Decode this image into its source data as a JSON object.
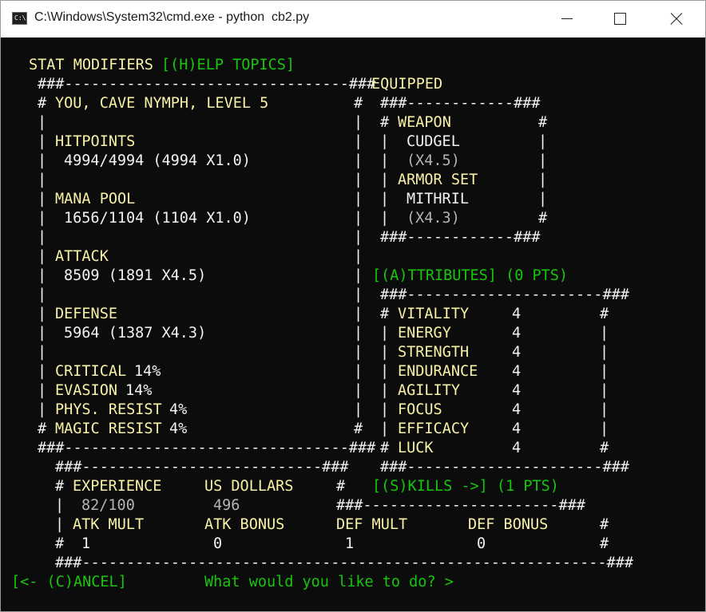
{
  "window": {
    "title": "C:\\Windows\\System32\\cmd.exe - python  cb2.py",
    "icon": "cmd-console-icon",
    "icon_text": "C:\\"
  },
  "colors": {
    "yellow": "#f9f1a5",
    "green": "#16c60c",
    "white": "#f2f2f2",
    "dim": "#b4b4b4"
  },
  "header": {
    "stat_modifiers": "STAT MODIFIERS",
    "help_topics": "[(H)ELP TOPICS]"
  },
  "stats": {
    "top_border": "###--------------------------------###",
    "player": "YOU, CAVE NYMPH, LEVEL 5",
    "hitpoints_label": "HITPOINTS",
    "hitpoints_value": "4994/4994 (4994 X1.0)",
    "mana_label": "MANA POOL",
    "mana_value": "1656/1104 (1104 X1.0)",
    "attack_label": "ATTACK",
    "attack_value": "8509 (1891 X4.5)",
    "defense_label": "DEFENSE",
    "defense_value": "5964 (1387 X4.3)",
    "critical_label": "CRITICAL",
    "critical_value": "14%",
    "evasion_label": "EVASION",
    "evasion_value": "14%",
    "phys_resist_label": "PHYS. RESIST",
    "phys_resist_value": "4%",
    "magic_resist_label": "MAGIC RESIST",
    "magic_resist_value": "4%",
    "bottom_border": "###--------------------------------###"
  },
  "equipped": {
    "title": "EQUIPPED",
    "border": "###------------###",
    "weapon_label": "WEAPON",
    "weapon_name": "CUDGEL",
    "weapon_mult": "(X4.5)",
    "armor_label": "ARMOR SET",
    "armor_name": "MITHRIL",
    "armor_mult": "(X4.3)"
  },
  "attributes": {
    "title": "[(A)TTRIBUTES] (0 PTS)",
    "border": "###----------------------###",
    "items": [
      {
        "name": "VITALITY",
        "value": "4"
      },
      {
        "name": "ENERGY",
        "value": "4"
      },
      {
        "name": "STRENGTH",
        "value": "4"
      },
      {
        "name": "ENDURANCE",
        "value": "4"
      },
      {
        "name": "AGILITY",
        "value": "4"
      },
      {
        "name": "FOCUS",
        "value": "4"
      },
      {
        "name": "EFFICACY",
        "value": "4"
      },
      {
        "name": "LUCK",
        "value": "4"
      }
    ]
  },
  "progress": {
    "border": "###---------------------------###",
    "experience_label": "EXPERIENCE",
    "experience_value": "82/100",
    "dollars_label": "US DOLLARS",
    "dollars_value": "496",
    "atk_mult_label": "ATK MULT",
    "atk_mult_value": "1",
    "atk_bonus_label": "ATK BONUS",
    "atk_bonus_value": "0",
    "def_mult_label": "DEF MULT",
    "def_mult_value": "1",
    "def_bonus_label": "DEF BONUS",
    "def_bonus_value": "0",
    "bottom_border": "###-----------------------------------------------------------###"
  },
  "skills": {
    "title": "[(S)KILLS ->] (1 PTS)",
    "border": "###----------------------###"
  },
  "footer": {
    "cancel": "[<- (C)ANCEL]",
    "prompt": "What would you like to do? >"
  }
}
